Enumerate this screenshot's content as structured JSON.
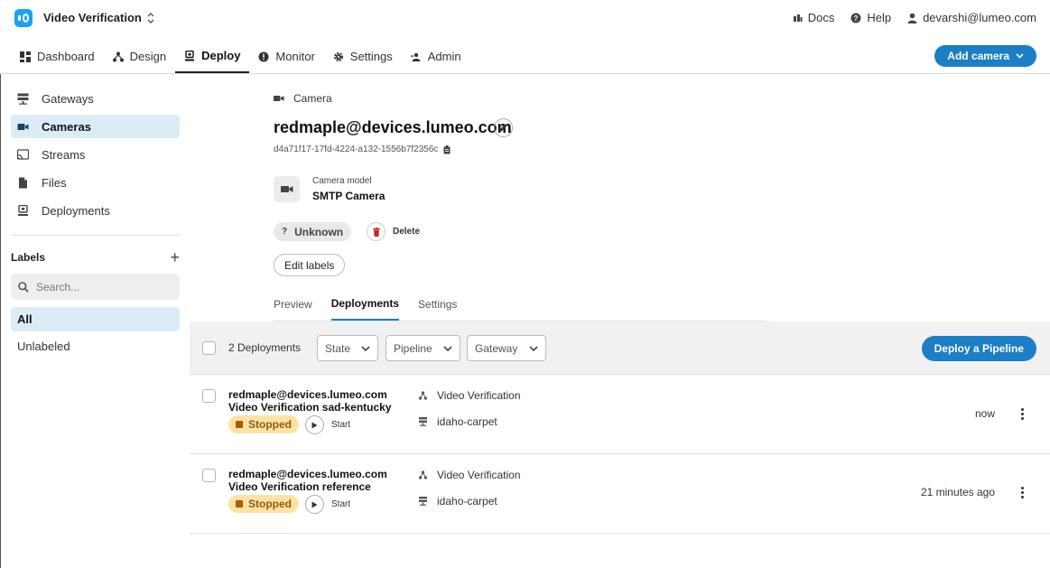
{
  "header": {
    "app_title": "Video Verification",
    "docs": "Docs",
    "help": "Help",
    "user": "devarshi@lumeo.com",
    "add_camera": "Add camera"
  },
  "nav": {
    "tabs": [
      {
        "label": "Dashboard",
        "icon": "dashboard-icon"
      },
      {
        "label": "Design",
        "icon": "design-icon"
      },
      {
        "label": "Deploy",
        "icon": "deploy-icon",
        "active": true
      },
      {
        "label": "Monitor",
        "icon": "monitor-icon"
      },
      {
        "label": "Settings",
        "icon": "settings-icon"
      },
      {
        "label": "Admin",
        "icon": "admin-icon"
      }
    ]
  },
  "sidebar": {
    "items": [
      {
        "label": "Gateways",
        "icon": "gateway-icon"
      },
      {
        "label": "Cameras",
        "icon": "camera-icon",
        "active": true
      },
      {
        "label": "Streams",
        "icon": "stream-icon"
      },
      {
        "label": "Files",
        "icon": "file-icon"
      },
      {
        "label": "Deployments",
        "icon": "deployment-icon"
      }
    ],
    "labels_title": "Labels",
    "search_placeholder": "Search...",
    "label_all": "All",
    "label_unlabeled": "Unlabeled"
  },
  "camera": {
    "breadcrumb": "Camera",
    "name": "redmaple@devices.lumeo.com",
    "id": "d4a71f17-17fd-4224-a132-1556b7f2356c",
    "model_label": "Camera model",
    "model_value": "SMTP Camera",
    "status": "Unknown",
    "delete": "Delete",
    "edit_labels": "Edit labels"
  },
  "tabs": {
    "preview": "Preview",
    "deployments": "Deployments",
    "settings": "Settings"
  },
  "deployments": {
    "count": "2 Deployments",
    "filter_state": "State",
    "filter_pipeline": "Pipeline",
    "filter_gateway": "Gateway",
    "deploy_button": "Deploy a Pipeline",
    "rows": [
      {
        "camera": "redmaple@devices.lumeo.com",
        "name": "Video Verification sad-kentucky",
        "status": "Stopped",
        "start": "Start",
        "pipeline": "Video Verification",
        "gateway": "idaho-carpet",
        "time": "now"
      },
      {
        "camera": "redmaple@devices.lumeo.com",
        "name": "Video Verification reference",
        "status": "Stopped",
        "start": "Start",
        "pipeline": "Video Verification",
        "gateway": "idaho-carpet",
        "time": "21 minutes ago"
      }
    ]
  }
}
